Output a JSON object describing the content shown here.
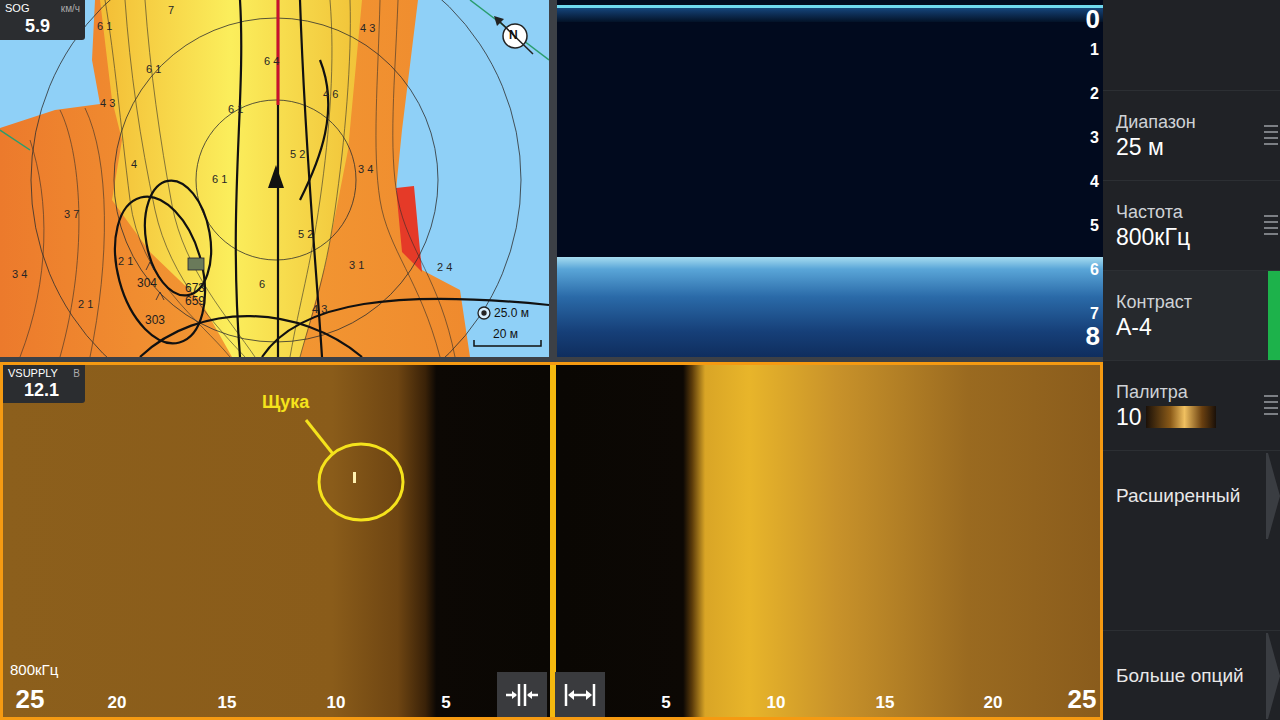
{
  "map": {
    "sog_label": "SOG",
    "sog_unit": "км/ч",
    "sog_value": "5.9",
    "compass": "N",
    "range": "25.0 м",
    "scale": "20 м",
    "depth_labels": [
      "6 1",
      "7",
      "4 3",
      "6 1",
      "6 4",
      "6 1",
      "4 6",
      "4 3",
      "5 2",
      "3 4",
      "4",
      "3 7",
      "6 1",
      "5 2",
      "3 1",
      "2 4",
      "3 4",
      "2 1",
      "6",
      "2 1",
      "4 3"
    ],
    "waypoints": [
      "304",
      "673",
      "659",
      "303"
    ]
  },
  "sonar": {
    "depth_scale": [
      "0",
      "1",
      "2",
      "3",
      "4",
      "5",
      "6",
      "7",
      "8"
    ]
  },
  "sidescan": {
    "voltage_label": "VSUPPLY",
    "voltage_unit": "В",
    "voltage_value": "12.1",
    "target": "Щука",
    "frequency": "800кГц",
    "scale": [
      "25",
      "20",
      "15",
      "10",
      "5",
      "5",
      "10",
      "15",
      "20",
      "25"
    ]
  },
  "sidebar": {
    "items": [
      {
        "label": "Диапазон",
        "value": "25 м",
        "kind": "setting",
        "selected": false
      },
      {
        "label": "Частота",
        "value": "800кГц",
        "kind": "setting",
        "selected": false
      },
      {
        "label": "Контраст",
        "value": "А-4",
        "kind": "setting",
        "selected": true
      },
      {
        "label": "Палитра",
        "value": "10",
        "kind": "palette",
        "selected": false
      },
      {
        "label": "Расширенный",
        "kind": "submenu",
        "selected": false
      },
      {
        "label": "Больше опций",
        "kind": "submenu",
        "selected": false
      }
    ]
  }
}
